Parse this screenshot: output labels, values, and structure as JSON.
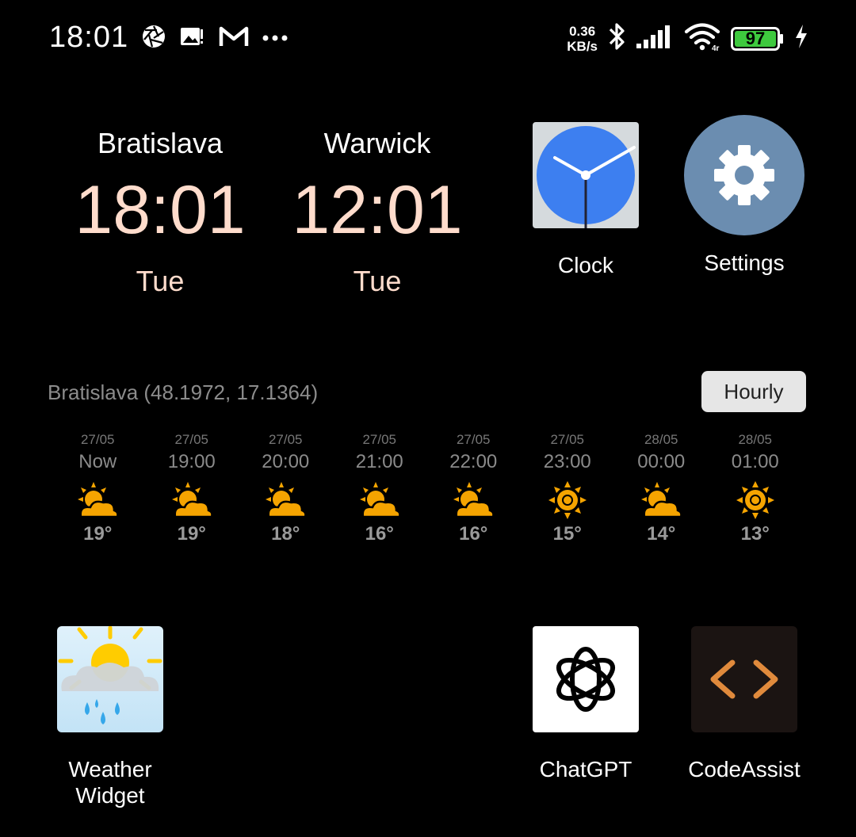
{
  "status_bar": {
    "time": "18:01",
    "net_speed_value": "0.36",
    "net_speed_unit": "KB/s",
    "battery": "97"
  },
  "world_clock": [
    {
      "city": "Bratislava",
      "time": "18:01",
      "day": "Tue"
    },
    {
      "city": "Warwick",
      "time": "12:01",
      "day": "Tue"
    }
  ],
  "apps": {
    "clock": "Clock",
    "settings": "Settings",
    "weather_line1": "Weather",
    "weather_line2": "Widget",
    "chatgpt": "ChatGPT",
    "codeassist": "CodeAssist"
  },
  "weather": {
    "location": "Bratislava (48.1972, 17.1364)",
    "mode_button": "Hourly",
    "forecast": [
      {
        "date": "27/05",
        "time": "Now",
        "icon": "partly-sunny-icon",
        "temp": "19°"
      },
      {
        "date": "27/05",
        "time": "19:00",
        "icon": "partly-sunny-icon",
        "temp": "19°"
      },
      {
        "date": "27/05",
        "time": "20:00",
        "icon": "partly-sunny-icon",
        "temp": "18°"
      },
      {
        "date": "27/05",
        "time": "21:00",
        "icon": "partly-sunny-icon",
        "temp": "16°"
      },
      {
        "date": "27/05",
        "time": "22:00",
        "icon": "partly-sunny-icon",
        "temp": "16°"
      },
      {
        "date": "27/05",
        "time": "23:00",
        "icon": "sun-icon",
        "temp": "15°"
      },
      {
        "date": "28/05",
        "time": "00:00",
        "icon": "partly-sunny-icon",
        "temp": "14°"
      },
      {
        "date": "28/05",
        "time": "01:00",
        "icon": "sun-icon",
        "temp": "13°"
      }
    ]
  },
  "colors": {
    "clock_time": "#ffdccc",
    "weather_orange": "#f5a400",
    "battery_green": "#3ec93e"
  }
}
